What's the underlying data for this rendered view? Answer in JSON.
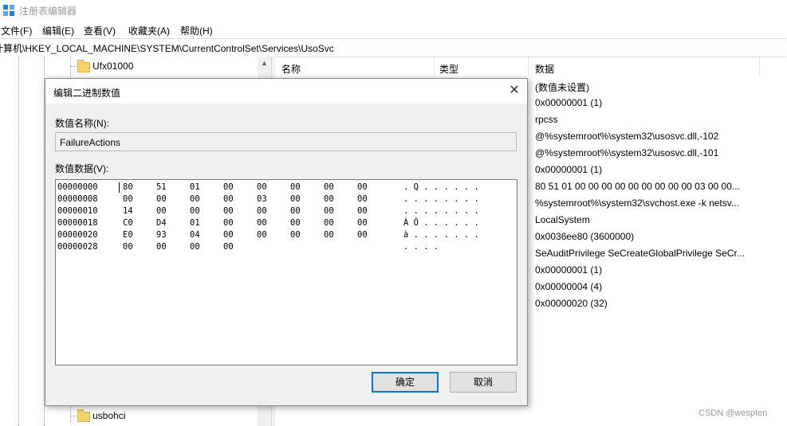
{
  "window": {
    "title": "注册表编辑器",
    "icon": "registry-icon"
  },
  "menu": [
    "文件(F)",
    "编辑(E)",
    "查看(V)",
    "收藏夹(A)",
    "帮助(H)"
  ],
  "address": "计算机\\HKEY_LOCAL_MACHINE\\SYSTEM\\CurrentControlSet\\Services\\UsoSvc",
  "tree": {
    "items": [
      "Ufx01000",
      "Ufx01000",
      "usbohci"
    ]
  },
  "list": {
    "columns": [
      "名称",
      "类型",
      "数据"
    ],
    "data": [
      "(数值未设置)",
      "0x00000001 (1)",
      "rpcss",
      "@%systemroot%\\system32\\usosvc.dll,-102",
      "@%systemroot%\\system32\\usosvc.dll,-101",
      "0x00000001 (1)",
      "80 51 01 00 00 00 00 00 00 00 00 00 03 00 00...",
      "%systemroot%\\system32\\svchost.exe -k netsv...",
      "LocalSystem",
      "0x0036ee80 (3600000)",
      "SeAuditPrivilege SeCreateGlobalPrivilege SeCr...",
      "0x00000001 (1)",
      "0x00000004 (4)",
      "0x00000020 (32)"
    ]
  },
  "dialog": {
    "title": "编辑二进制数值",
    "value_name_label": "数值名称(N):",
    "value_name": "FailureActions",
    "value_data_label": "数值数据(V):",
    "hex_rows": [
      {
        "offset": "00000000",
        "bytes": [
          "80",
          "51",
          "01",
          "00",
          "00",
          "00",
          "00",
          "00"
        ],
        "ascii": ". Q . . . . . ."
      },
      {
        "offset": "00000008",
        "bytes": [
          "00",
          "00",
          "00",
          "00",
          "03",
          "00",
          "00",
          "00"
        ],
        "ascii": ". . . . . . . ."
      },
      {
        "offset": "00000010",
        "bytes": [
          "14",
          "00",
          "00",
          "00",
          "00",
          "00",
          "00",
          "00"
        ],
        "ascii": ". . . . . . . ."
      },
      {
        "offset": "00000018",
        "bytes": [
          "C0",
          "D4",
          "01",
          "00",
          "00",
          "00",
          "00",
          "00"
        ],
        "ascii": "À Ô . . . . . ."
      },
      {
        "offset": "00000020",
        "bytes": [
          "E0",
          "93",
          "04",
          "00",
          "00",
          "00",
          "00",
          "00"
        ],
        "ascii": "à . . . . . . ."
      },
      {
        "offset": "00000028",
        "bytes": [
          "00",
          "00",
          "00",
          "00"
        ],
        "ascii": ". . . ."
      }
    ],
    "ok_label": "确定",
    "cancel_label": "取消"
  },
  "watermark": "CSDN @wespten"
}
